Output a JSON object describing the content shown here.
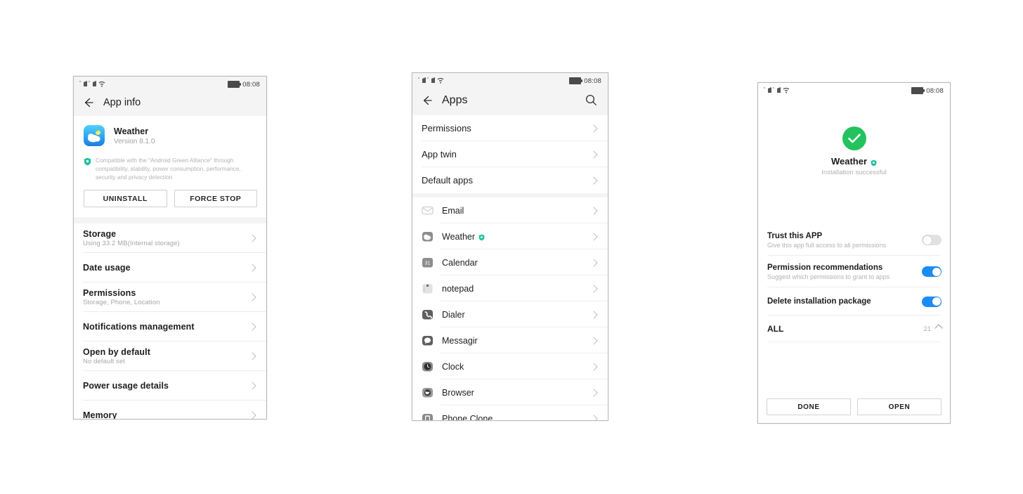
{
  "statusbar": {
    "signal_icon": "dual-signal-wifi-icon",
    "battery_icon": "battery-full-icon",
    "time": "08:08"
  },
  "phone1": {
    "appbar": {
      "back_icon": "back-arrow-icon",
      "title": "App info"
    },
    "app": {
      "icon": "weather-app-icon",
      "name": "Weather",
      "version": "Version 8.1.0"
    },
    "green_alliance": {
      "icon": "green-shield-icon",
      "text": "Compatible with the \"Android Green Alliance\" through compatibility, stability, power consumption, performance, security and privacy detection"
    },
    "buttons": {
      "uninstall": "UNINSTALL",
      "force_stop": "FORCE STOP"
    },
    "rows": [
      {
        "title": "Storage",
        "sub": "Using 33.2 MB(Internal storage)"
      },
      {
        "title": "Date usage",
        "sub": ""
      },
      {
        "title": "Permissions",
        "sub": "Storage, Phone, Location"
      },
      {
        "title": "Notifications management",
        "sub": ""
      },
      {
        "title": "Open by default",
        "sub": "No default set"
      },
      {
        "title": "Power usage details",
        "sub": ""
      },
      {
        "title": "Memory",
        "sub": ""
      }
    ]
  },
  "phone2": {
    "appbar": {
      "back_icon": "back-arrow-icon",
      "title": "Apps",
      "search_icon": "search-icon"
    },
    "settings_rows": [
      {
        "label": "Permissions"
      },
      {
        "label": "App twin"
      },
      {
        "label": "Default apps"
      }
    ],
    "app_rows": [
      {
        "label": "Email",
        "icon": "email-icon",
        "badge": ""
      },
      {
        "label": "Weather",
        "icon": "weather-icon",
        "badge": "green-shield-icon"
      },
      {
        "label": "Calendar",
        "icon": "calendar-icon",
        "badge": ""
      },
      {
        "label": "notepad",
        "icon": "notepad-icon",
        "badge": ""
      },
      {
        "label": "Dialer",
        "icon": "dialer-icon",
        "badge": ""
      },
      {
        "label": "Messagir",
        "icon": "message-icon",
        "badge": ""
      },
      {
        "label": "Clock",
        "icon": "clock-icon",
        "badge": ""
      },
      {
        "label": "Browser",
        "icon": "browser-icon",
        "badge": ""
      },
      {
        "label": "Phone Clone",
        "icon": "phone-clone-icon",
        "badge": ""
      }
    ]
  },
  "phone3": {
    "success": {
      "check_icon": "green-check-circle-icon",
      "app_name": "Weather",
      "badge_icon": "green-shield-icon",
      "subtitle": "Installation successful"
    },
    "options": [
      {
        "title": "Trust this APP",
        "sub": "Give this app full access to all permissions",
        "toggle": "off"
      },
      {
        "title": "Permission recommendations",
        "sub": "Suggest which permissions to grant to apps",
        "toggle": "on"
      },
      {
        "title": "Delete installation package",
        "sub": "",
        "toggle": "on"
      }
    ],
    "all_row": {
      "label": "ALL",
      "count": "21",
      "caret_icon": "chevron-up-icon"
    },
    "buttons": {
      "done": "DONE",
      "open": "OPEN"
    }
  },
  "colors": {
    "accent_blue": "#1a8cf5",
    "success_green": "#22c35e",
    "app_icon_blue": "#2fb8f5",
    "status_bg": "#f4f4f4"
  }
}
